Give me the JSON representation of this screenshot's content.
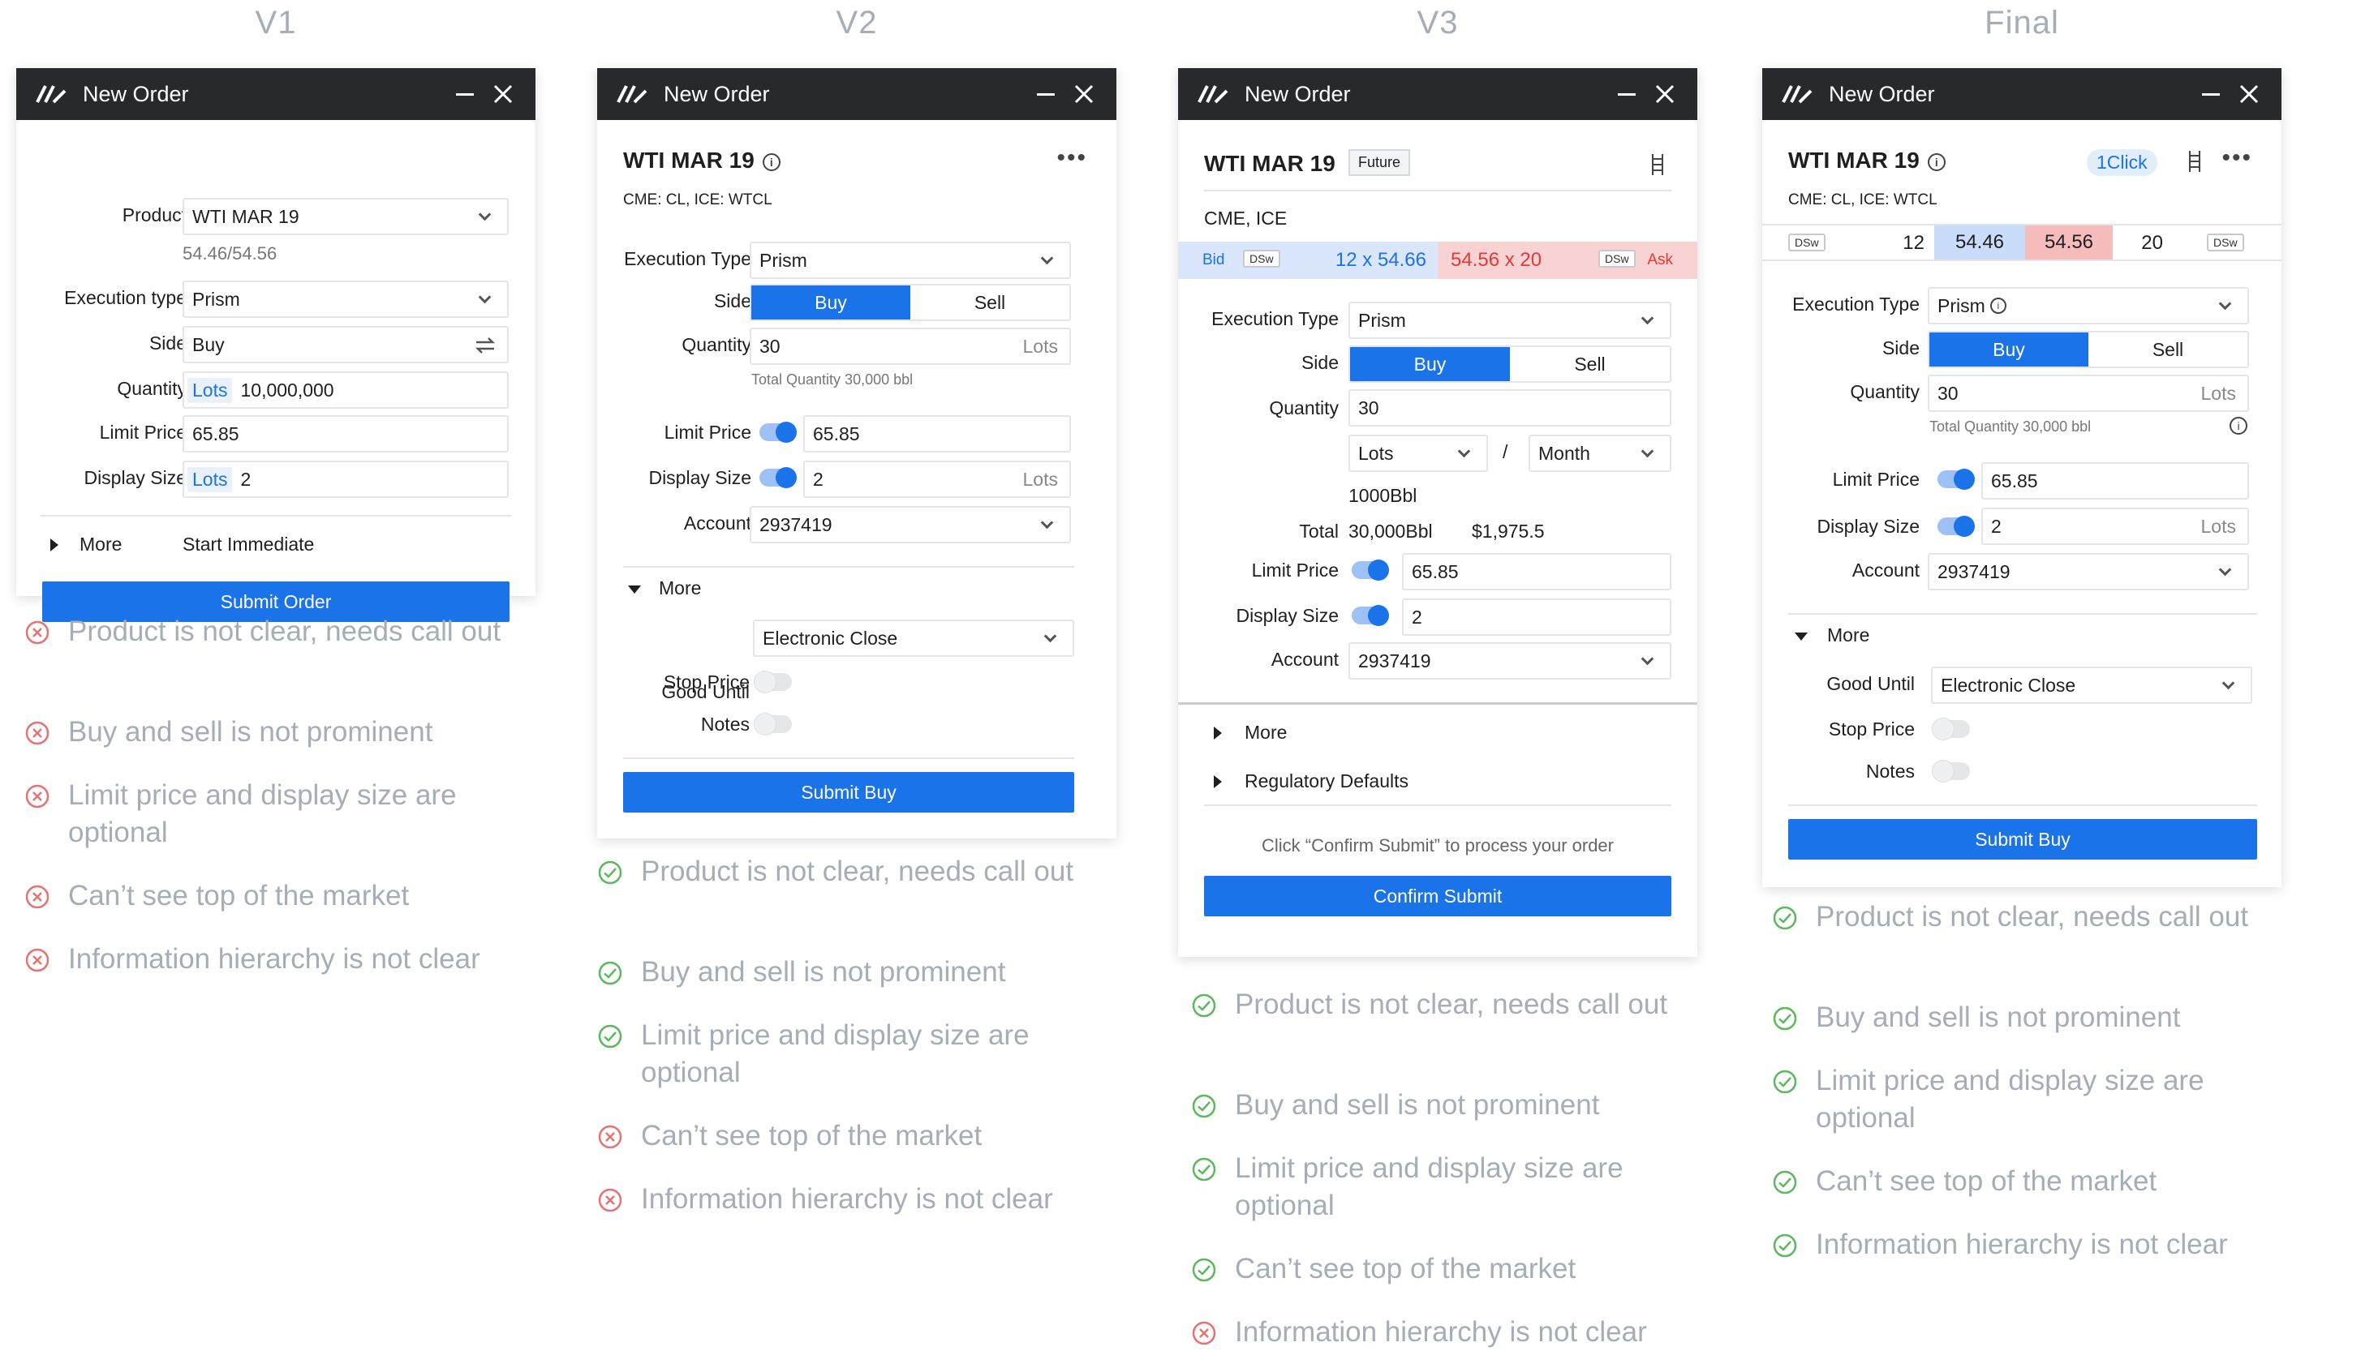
{
  "colors": {
    "accent": "#1a73e8",
    "titlebar": "#27292c",
    "bid_bg": "#d9e6fb",
    "ask_bg": "#f9d3d3",
    "bid_text": "#1a73e8",
    "ask_text": "#e53935",
    "ok": "#5cb85c",
    "bad": "#e57373",
    "note_text": "#a6adb6"
  },
  "v1": {
    "title": "V1",
    "window_title": "New Order",
    "product_label": "Product",
    "product_value": "WTI MAR 19",
    "bidask": "54.46/54.56",
    "exec_label": "Execution type",
    "exec_value": "Prism",
    "side_label": "Side",
    "side_value": "Buy",
    "qty_label": "Quantity",
    "qty_unit": "Lots",
    "qty_value": "10,000,000",
    "limit_label": "Limit Price",
    "limit_value": "65.85",
    "display_label": "Display Size",
    "display_unit": "Lots",
    "display_value": "2",
    "more_label": "More",
    "more_value": "Start Immediate",
    "submit": "Submit Order",
    "notes": [
      {
        "text": "Product is not clear, needs call out",
        "status": "bad"
      },
      {
        "text": "Buy and sell is not prominent",
        "status": "bad"
      },
      {
        "text": "Limit price and display size are optional",
        "status": "bad"
      },
      {
        "text": "Can’t see top of the market",
        "status": "bad"
      },
      {
        "text": "Information hierarchy is not clear",
        "status": "bad"
      }
    ]
  },
  "v2": {
    "title": "V2",
    "window_title": "New Order",
    "product": "WTI MAR 19",
    "exchange": "CME: CL, ICE: WTCL",
    "exec_label": "Execution Type",
    "exec_value": "Prism",
    "side_label": "Side",
    "buy": "Buy",
    "sell": "Sell",
    "qty_label": "Quantity",
    "qty_value": "30",
    "qty_unit": "Lots",
    "qty_total": "Total Quantity 30,000 bbl",
    "limit_label": "Limit Price",
    "limit_value": "65.85",
    "display_label": "Display Size",
    "display_value": "2",
    "display_unit": "Lots",
    "account_label": "Account",
    "account_value": "2937419",
    "more_label": "More",
    "good_label": "Good Until",
    "good_value": "Electronic Close",
    "stop_label": "Stop Price",
    "notes_label": "Notes",
    "submit": "Submit Buy",
    "notes": [
      {
        "text": "Product is not clear, needs call out",
        "status": "ok"
      },
      {
        "text": "Buy and sell is not prominent",
        "status": "ok"
      },
      {
        "text": "Limit price and display size are optional",
        "status": "ok"
      },
      {
        "text": "Can’t see top of the market",
        "status": "bad"
      },
      {
        "text": "Information hierarchy is not clear",
        "status": "bad"
      }
    ]
  },
  "v3": {
    "title": "V3",
    "window_title": "New Order",
    "product": "WTI MAR 19",
    "badge": "Future",
    "exchange": "CME, ICE",
    "bid_label": "Bid",
    "dsw": "DSw",
    "bid_qp": "12 x 54.66",
    "ask_qp": "54.56 x 20",
    "ask_label": "Ask",
    "exec_label": "Execution Type",
    "exec_value": "Prism",
    "side_label": "Side",
    "buy": "Buy",
    "sell": "Sell",
    "qty_label": "Quantity",
    "qty_value": "30",
    "unit_value": "Lots",
    "slash": "/",
    "period_value": "Month",
    "bbl": "1000Bbl",
    "total_label": "Total",
    "total_value": "30,000Bbl",
    "total_price": "$1,975.5",
    "limit_label": "Limit Price",
    "limit_value": "65.85",
    "display_label": "Display Size",
    "display_value": "2",
    "account_label": "Account",
    "account_value": "2937419",
    "more_label": "More",
    "reg_label": "Regulatory Defaults",
    "confirm_hint": "Click “Confirm Submit” to process your order",
    "submit": "Confirm Submit",
    "notes": [
      {
        "text": "Product is not clear, needs call out",
        "status": "ok"
      },
      {
        "text": "Buy and sell is not prominent",
        "status": "ok"
      },
      {
        "text": "Limit price and display size are optional",
        "status": "ok"
      },
      {
        "text": "Can’t see top of the market",
        "status": "ok"
      },
      {
        "text": "Information hierarchy is not clear",
        "status": "bad"
      }
    ]
  },
  "final": {
    "title": "Final",
    "window_title": "New Order",
    "product": "WTI MAR 19",
    "oneclick": "1Click",
    "exchange": "CME: CL, ICE: WTCL",
    "dsw": "DSw",
    "bid_qty": "12",
    "bid": "54.46",
    "ask": "54.56",
    "ask_qty": "20",
    "exec_label": "Execution Type",
    "exec_value": "Prism",
    "side_label": "Side",
    "buy": "Buy",
    "sell": "Sell",
    "qty_label": "Quantity",
    "qty_value": "30",
    "qty_unit": "Lots",
    "qty_total": "Total Quantity 30,000 bbl",
    "limit_label": "Limit Price",
    "limit_value": "65.85",
    "display_label": "Display Size",
    "display_value": "2",
    "display_unit": "Lots",
    "account_label": "Account",
    "account_value": "2937419",
    "more_label": "More",
    "good_label": "Good Until",
    "good_value": "Electronic Close",
    "stop_label": "Stop Price",
    "notes_label": "Notes",
    "submit": "Submit Buy",
    "notes": [
      {
        "text": "Product is not clear, needs call out",
        "status": "ok"
      },
      {
        "text": "Buy and sell is not prominent",
        "status": "ok"
      },
      {
        "text": "Limit price and display size are optional",
        "status": "ok"
      },
      {
        "text": "Can’t see top of the market",
        "status": "ok"
      },
      {
        "text": "Information hierarchy is not clear",
        "status": "ok"
      }
    ]
  }
}
